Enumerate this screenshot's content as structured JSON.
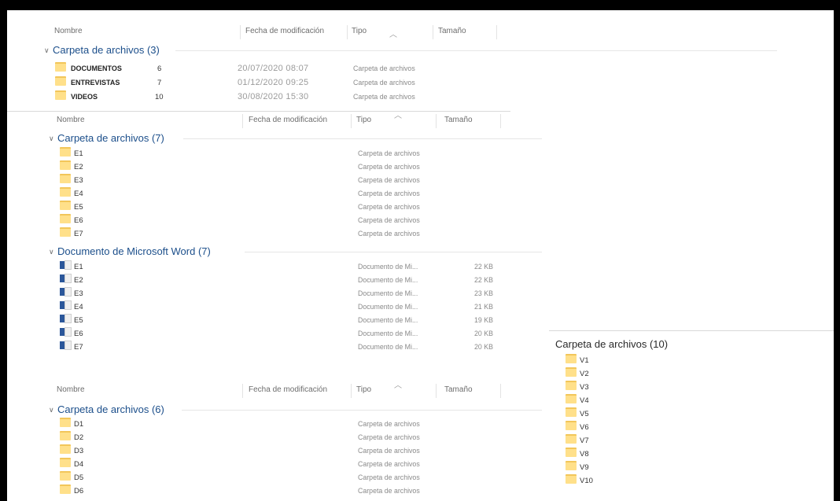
{
  "headers": {
    "name": "Nombre",
    "date": "Fecha de modificación",
    "type": "Tipo",
    "size": "Tamaño",
    "sort_icon": "sort-ascending-caret-icon"
  },
  "panel1": {
    "group_label": "Carpeta de archivos (3)",
    "items": [
      {
        "name": "DOCUMENTOS",
        "count": "6",
        "date": "20/07/2020 08:07",
        "type": "Carpeta de archivos"
      },
      {
        "name": "ENTREVISTAS",
        "count": "7",
        "date": "01/12/2020 09:25",
        "type": "Carpeta de archivos"
      },
      {
        "name": "VIDEOS",
        "count": "10",
        "date": "30/08/2020 15:30",
        "type": "Carpeta de archivos"
      }
    ]
  },
  "panel2": {
    "folders_label": "Carpeta de archivos (7)",
    "folders": [
      {
        "name": "E1",
        "type": "Carpeta de archivos"
      },
      {
        "name": "E2",
        "type": "Carpeta de archivos"
      },
      {
        "name": "E3",
        "type": "Carpeta de archivos"
      },
      {
        "name": "E4",
        "type": "Carpeta de archivos"
      },
      {
        "name": "E5",
        "type": "Carpeta de archivos"
      },
      {
        "name": "E6",
        "type": "Carpeta de archivos"
      },
      {
        "name": "E7",
        "type": "Carpeta de archivos"
      }
    ],
    "docs_label": "Documento de Microsoft Word (7)",
    "docs": [
      {
        "name": "E1",
        "type": "Documento de Mi...",
        "size": "22 KB"
      },
      {
        "name": "E2",
        "type": "Documento de Mi...",
        "size": "22 KB"
      },
      {
        "name": "E3",
        "type": "Documento de Mi...",
        "size": "23 KB"
      },
      {
        "name": "E4",
        "type": "Documento de Mi...",
        "size": "21 KB"
      },
      {
        "name": "E5",
        "type": "Documento de Mi...",
        "size": "19 KB"
      },
      {
        "name": "E6",
        "type": "Documento de Mi...",
        "size": "20 KB"
      },
      {
        "name": "E7",
        "type": "Documento de Mi...",
        "size": "20 KB"
      }
    ]
  },
  "panel3": {
    "group_label": "Carpeta de archivos (6)",
    "folders": [
      {
        "name": "D1",
        "type": "Carpeta de archivos"
      },
      {
        "name": "D2",
        "type": "Carpeta de archivos"
      },
      {
        "name": "D3",
        "type": "Carpeta de archivos"
      },
      {
        "name": "D4",
        "type": "Carpeta de archivos"
      },
      {
        "name": "D5",
        "type": "Carpeta de archivos"
      },
      {
        "name": "D6",
        "type": "Carpeta de archivos"
      }
    ]
  },
  "panel4": {
    "group_label": "Carpeta de archivos (10)",
    "folders": [
      {
        "name": "V1"
      },
      {
        "name": "V2"
      },
      {
        "name": "V3"
      },
      {
        "name": "V4"
      },
      {
        "name": "V5"
      },
      {
        "name": "V6"
      },
      {
        "name": "V7"
      },
      {
        "name": "V8"
      },
      {
        "name": "V9"
      },
      {
        "name": "V10"
      }
    ]
  },
  "colors": {
    "group_text": "#1c4f8b",
    "folder_fill": "#ffe08a",
    "word_blue": "#2b579a"
  },
  "icons": {
    "folder": "folder-icon",
    "word_doc": "word-document-icon",
    "collapse": "chevron-down-icon"
  }
}
